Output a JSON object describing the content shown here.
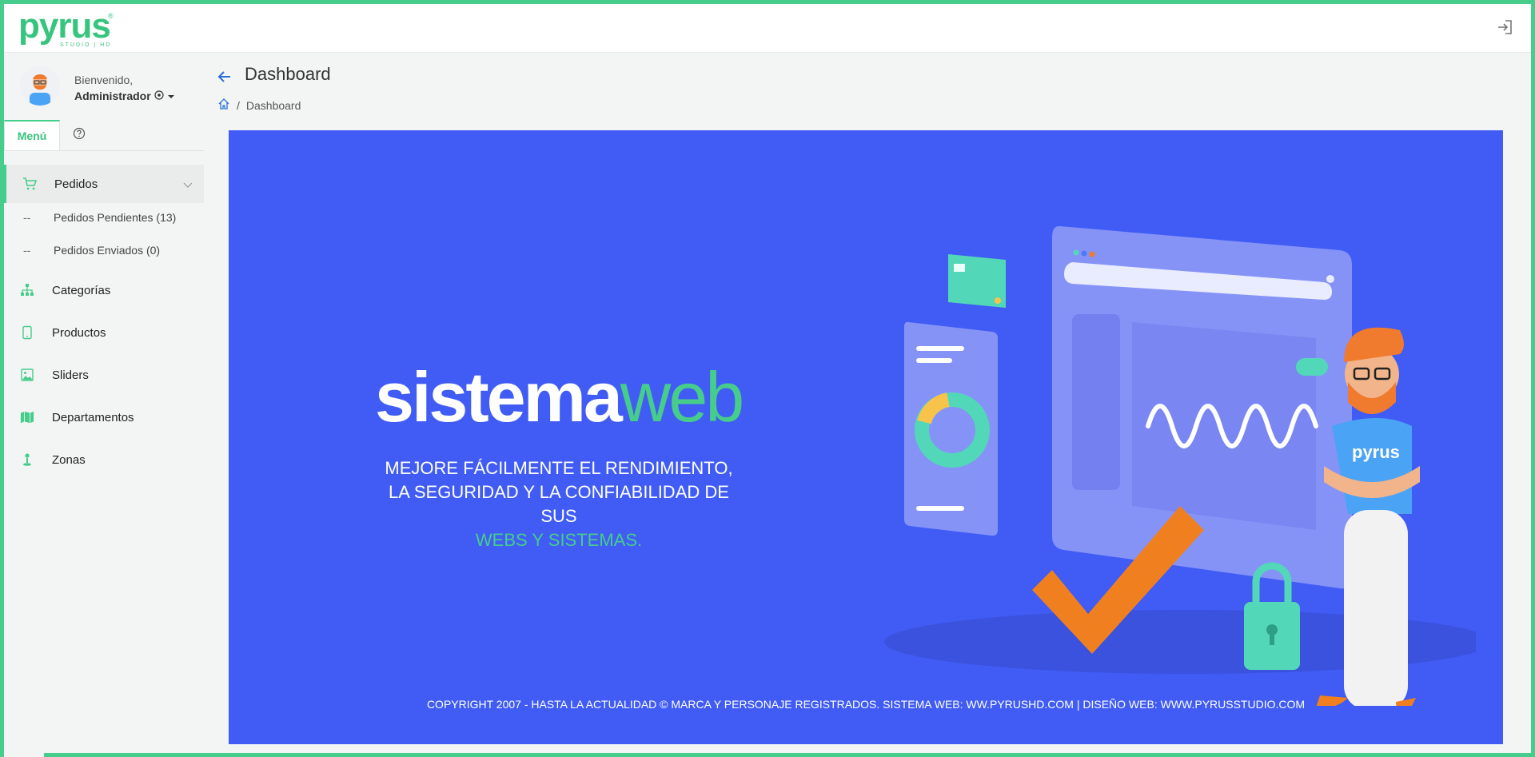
{
  "brand": {
    "logo_text": "pyrus",
    "logo_sub": "STUDIO | HD",
    "accent": "#46cc8b",
    "banner_bg": "#405cf5"
  },
  "user": {
    "greeting": "Bienvenido,",
    "name": "Administrador"
  },
  "sidebar": {
    "tabs": [
      "Menú"
    ],
    "items": [
      {
        "label": "Pedidos",
        "icon": "cart-icon",
        "expanded": true,
        "children": [
          {
            "prefix": "--",
            "label": "Pedidos Pendientes (13)"
          },
          {
            "prefix": "--",
            "label": "Pedidos Enviados (0)"
          }
        ]
      },
      {
        "label": "Categorías",
        "icon": "sitemap-icon"
      },
      {
        "label": "Productos",
        "icon": "tablet-icon"
      },
      {
        "label": "Sliders",
        "icon": "image-icon"
      },
      {
        "label": "Departamentos",
        "icon": "map-icon"
      },
      {
        "label": "Zonas",
        "icon": "map-pin-icon"
      }
    ]
  },
  "page": {
    "title": "Dashboard",
    "breadcrumb": [
      "Dashboard"
    ]
  },
  "banner": {
    "title_a": "sistema",
    "title_b": "web",
    "line1": "MEJORE FÁCILMENTE EL RENDIMIENTO,",
    "line2": "LA SEGURIDAD Y LA CONFIABILIDAD DE SUS",
    "line3": "WEBS Y SISTEMAS.",
    "character_shirt": "pyrus",
    "copyright": "COPYRIGHT 2007 - HASTA LA ACTUALIDAD © MARCA Y PERSONAJE REGISTRADOS. SISTEMA WEB: WW.PYRUSHD.COM | DISEÑO WEB: WWW.PYRUSSTUDIO.COM"
  }
}
